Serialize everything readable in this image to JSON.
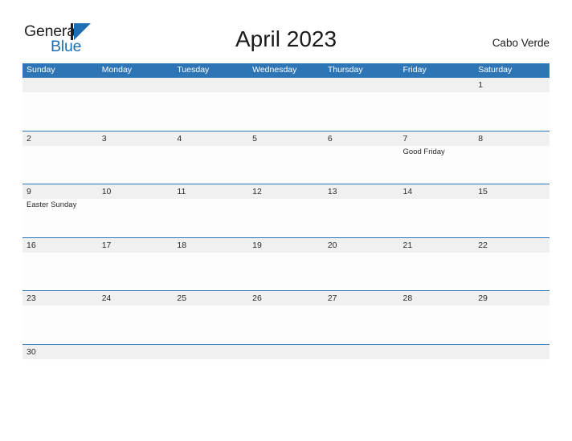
{
  "brand": {
    "name_part1": "General",
    "name_part2": "Blue",
    "triangle_color": "#1e6eb4",
    "text_color": "#231f20"
  },
  "header": {
    "title": "April 2023",
    "region": "Cabo Verde"
  },
  "theme": {
    "header_blue": "#2e75b6",
    "band_gray": "#f0f0f0",
    "page_background": "#ffffff"
  },
  "calendar": {
    "day_headers": [
      "Sunday",
      "Monday",
      "Tuesday",
      "Wednesday",
      "Thursday",
      "Friday",
      "Saturday"
    ],
    "weeks": [
      {
        "days": [
          {
            "date": "",
            "event": ""
          },
          {
            "date": "",
            "event": ""
          },
          {
            "date": "",
            "event": ""
          },
          {
            "date": "",
            "event": ""
          },
          {
            "date": "",
            "event": ""
          },
          {
            "date": "",
            "event": ""
          },
          {
            "date": "1",
            "event": ""
          }
        ]
      },
      {
        "days": [
          {
            "date": "2",
            "event": ""
          },
          {
            "date": "3",
            "event": ""
          },
          {
            "date": "4",
            "event": ""
          },
          {
            "date": "5",
            "event": ""
          },
          {
            "date": "6",
            "event": ""
          },
          {
            "date": "7",
            "event": "Good Friday"
          },
          {
            "date": "8",
            "event": ""
          }
        ]
      },
      {
        "days": [
          {
            "date": "9",
            "event": "Easter Sunday"
          },
          {
            "date": "10",
            "event": ""
          },
          {
            "date": "11",
            "event": ""
          },
          {
            "date": "12",
            "event": ""
          },
          {
            "date": "13",
            "event": ""
          },
          {
            "date": "14",
            "event": ""
          },
          {
            "date": "15",
            "event": ""
          }
        ]
      },
      {
        "days": [
          {
            "date": "16",
            "event": ""
          },
          {
            "date": "17",
            "event": ""
          },
          {
            "date": "18",
            "event": ""
          },
          {
            "date": "19",
            "event": ""
          },
          {
            "date": "20",
            "event": ""
          },
          {
            "date": "21",
            "event": ""
          },
          {
            "date": "22",
            "event": ""
          }
        ]
      },
      {
        "days": [
          {
            "date": "23",
            "event": ""
          },
          {
            "date": "24",
            "event": ""
          },
          {
            "date": "25",
            "event": ""
          },
          {
            "date": "26",
            "event": ""
          },
          {
            "date": "27",
            "event": ""
          },
          {
            "date": "28",
            "event": ""
          },
          {
            "date": "29",
            "event": ""
          }
        ]
      },
      {
        "days": [
          {
            "date": "30",
            "event": ""
          },
          {
            "date": "",
            "event": ""
          },
          {
            "date": "",
            "event": ""
          },
          {
            "date": "",
            "event": ""
          },
          {
            "date": "",
            "event": ""
          },
          {
            "date": "",
            "event": ""
          },
          {
            "date": "",
            "event": ""
          }
        ]
      }
    ]
  }
}
